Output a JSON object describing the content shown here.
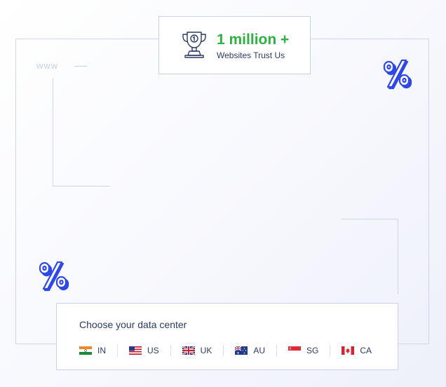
{
  "hero": {
    "www_label": "www",
    "trust": {
      "headline": "1 million +",
      "subtext": "Websites Trust Us",
      "icon": "trophy-icon",
      "headline_color": "#2fb041"
    },
    "decor_icons": [
      "percent-icon",
      "percent-icon"
    ]
  },
  "data_center": {
    "title": "Choose your data center",
    "options": [
      {
        "code": "IN",
        "flag": "india-flag-icon"
      },
      {
        "code": "US",
        "flag": "usa-flag-icon"
      },
      {
        "code": "UK",
        "flag": "uk-flag-icon"
      },
      {
        "code": "AU",
        "flag": "australia-flag-icon"
      },
      {
        "code": "SG",
        "flag": "singapore-flag-icon"
      },
      {
        "code": "CA",
        "flag": "canada-flag-icon"
      }
    ]
  },
  "colors": {
    "accent_blue": "#2f48e8",
    "text_navy": "#2d3a66",
    "border": "#c9d1ea"
  }
}
